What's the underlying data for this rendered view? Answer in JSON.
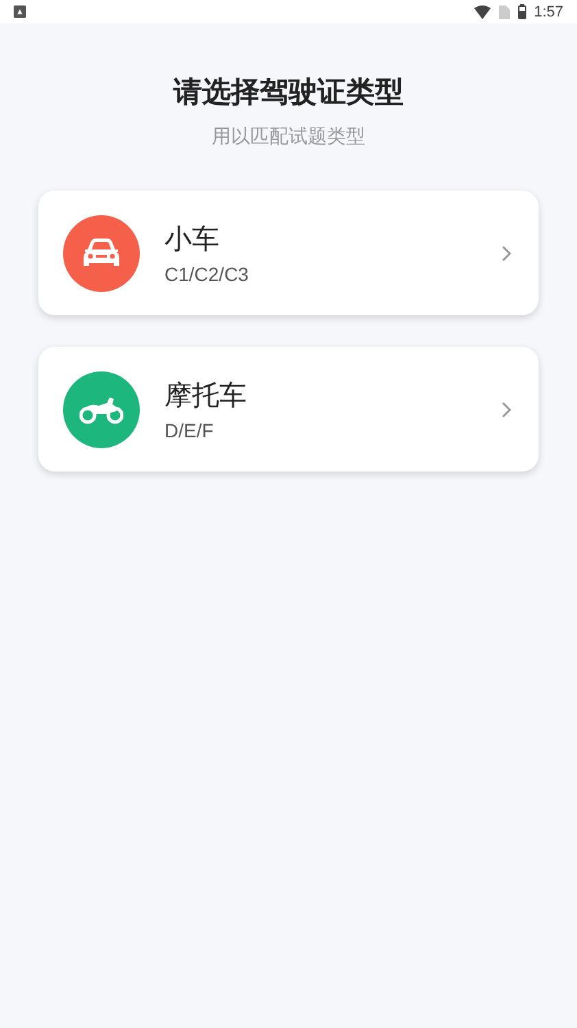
{
  "status_bar": {
    "time": "1:57"
  },
  "header": {
    "title": "请选择驾驶证类型",
    "subtitle": "用以匹配试题类型"
  },
  "license_types": [
    {
      "kind": "car",
      "color": "#f4604a",
      "name": "小车",
      "classes": "C1/C2/C3"
    },
    {
      "kind": "motorcycle",
      "color": "#1db67d",
      "name": "摩托车",
      "classes": "D/E/F"
    }
  ]
}
